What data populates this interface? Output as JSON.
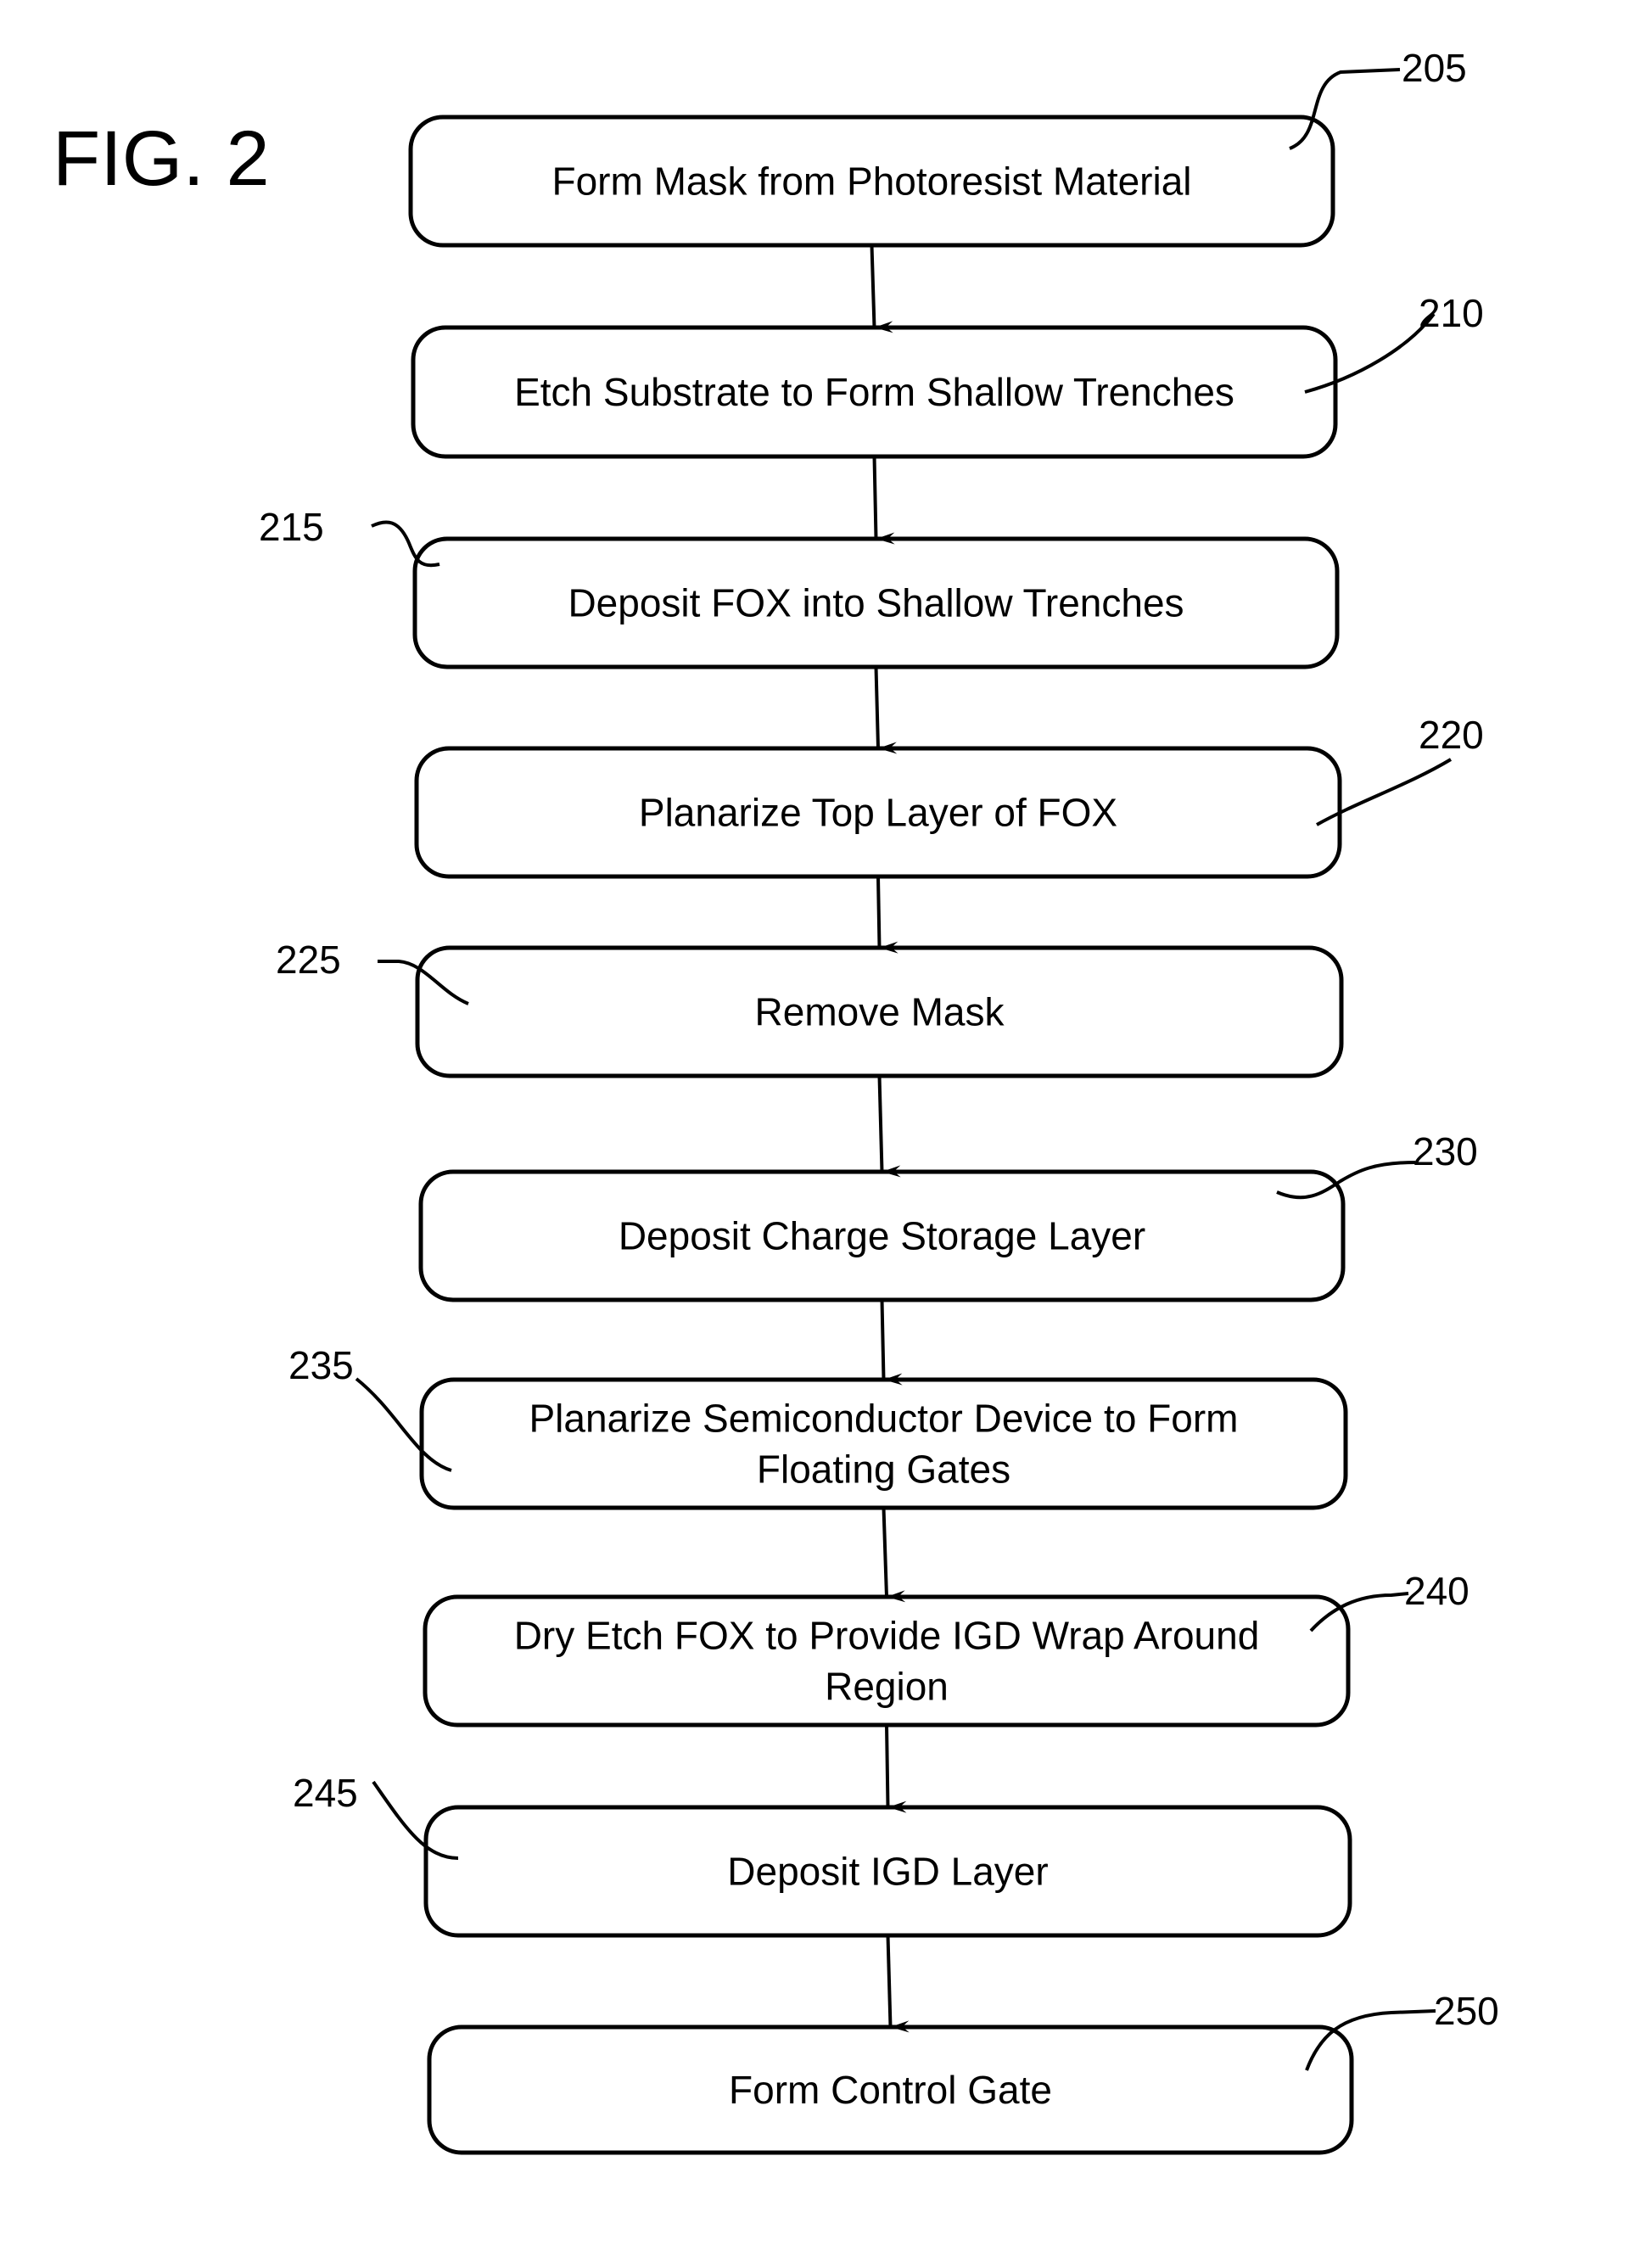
{
  "figure_title": "FIG. 2",
  "colors": {
    "line": "#000000",
    "background": "#ffffff"
  },
  "steps": [
    {
      "ref": "205",
      "lines": [
        "Form Mask from Photoresist Material"
      ]
    },
    {
      "ref": "210",
      "lines": [
        "Etch Substrate to Form Shallow Trenches"
      ]
    },
    {
      "ref": "215",
      "lines": [
        "Deposit FOX into Shallow Trenches"
      ]
    },
    {
      "ref": "220",
      "lines": [
        "Planarize Top Layer of FOX"
      ]
    },
    {
      "ref": "225",
      "lines": [
        "Remove Mask"
      ]
    },
    {
      "ref": "230",
      "lines": [
        "Deposit Charge Storage Layer"
      ]
    },
    {
      "ref": "235",
      "lines": [
        "Planarize Semiconductor Device to Form",
        "Floating Gates"
      ]
    },
    {
      "ref": "240",
      "lines": [
        "Dry Etch FOX to Provide IGD Wrap Around",
        "Region"
      ]
    },
    {
      "ref": "245",
      "lines": [
        "Deposit IGD Layer"
      ]
    },
    {
      "ref": "250",
      "lines": [
        "Form Control Gate"
      ]
    }
  ]
}
